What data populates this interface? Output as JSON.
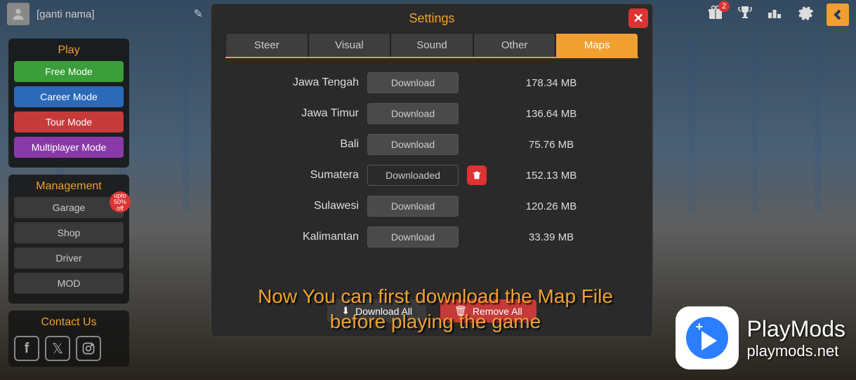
{
  "topbar": {
    "username": "[ganti nama]",
    "gift_badge": "2"
  },
  "sidebar": {
    "play_title": "Play",
    "modes": [
      "Free Mode",
      "Career Mode",
      "Tour Mode",
      "Multiplayer Mode"
    ],
    "mgmt_title": "Management",
    "mgmt_items": [
      "Garage",
      "Shop",
      "Driver",
      "MOD"
    ],
    "sale_badge": "upto\n50%\noff",
    "contact_title": "Contact Us"
  },
  "modal": {
    "title": "Settings",
    "tabs": [
      "Steer",
      "Visual",
      "Sound",
      "Other",
      "Maps"
    ],
    "maps": [
      {
        "name": "Jawa Tengah",
        "btn": "Download",
        "downloaded": false,
        "size": "178.34 MB"
      },
      {
        "name": "Jawa Timur",
        "btn": "Download",
        "downloaded": false,
        "size": "136.64 MB"
      },
      {
        "name": "Bali",
        "btn": "Download",
        "downloaded": false,
        "size": "75.76 MB"
      },
      {
        "name": "Sumatera",
        "btn": "Downloaded",
        "downloaded": true,
        "size": "152.13 MB"
      },
      {
        "name": "Sulawesi",
        "btn": "Download",
        "downloaded": false,
        "size": "120.26 MB"
      },
      {
        "name": "Kalimantan",
        "btn": "Download",
        "downloaded": false,
        "size": "33.39 MB"
      }
    ],
    "footer": {
      "download_all": "Download All",
      "remove_all": "Remove All"
    }
  },
  "overlay_text": "Now You can first download the Map File before playing the game",
  "watermark": {
    "title": "PlayMods",
    "sub": "playmods.net"
  }
}
